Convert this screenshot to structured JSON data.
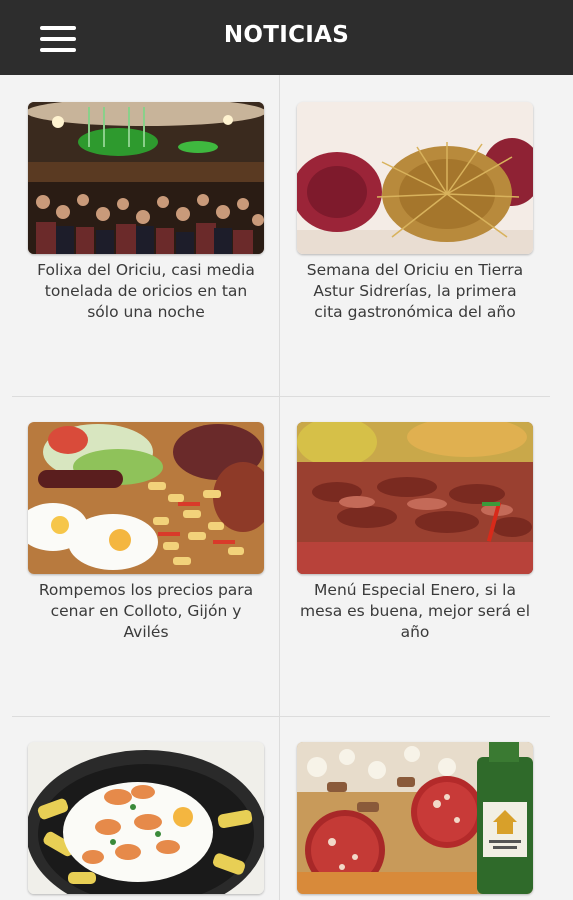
{
  "header": {
    "title": "NOTICIAS",
    "menu_icon": "hamburger-menu-icon",
    "background_color": "#2d2d2d"
  },
  "articles": [
    {
      "title": "Folixa del Oriciu, casi media tonelada de oricios en tan sólo una noche",
      "image": "crowd-event-photo"
    },
    {
      "title": "Semana del Oriciu en Tierra Astur Sidrerías, la primera cita gastronómica del año",
      "image": "sea-urchins-photo"
    },
    {
      "title": "Rompemos los precios para cenar en Colloto, Gijón y Avilés",
      "image": "fried-eggs-potatoes-sausage-photo"
    },
    {
      "title": "Menú Especial Enero, si la mesa es buena, mejor será el año",
      "image": "grilled-steak-photo"
    },
    {
      "title": "",
      "image": "eggs-prawns-potatoes-photo"
    },
    {
      "title": "",
      "image": "chorizo-cider-bottle-photo"
    }
  ]
}
